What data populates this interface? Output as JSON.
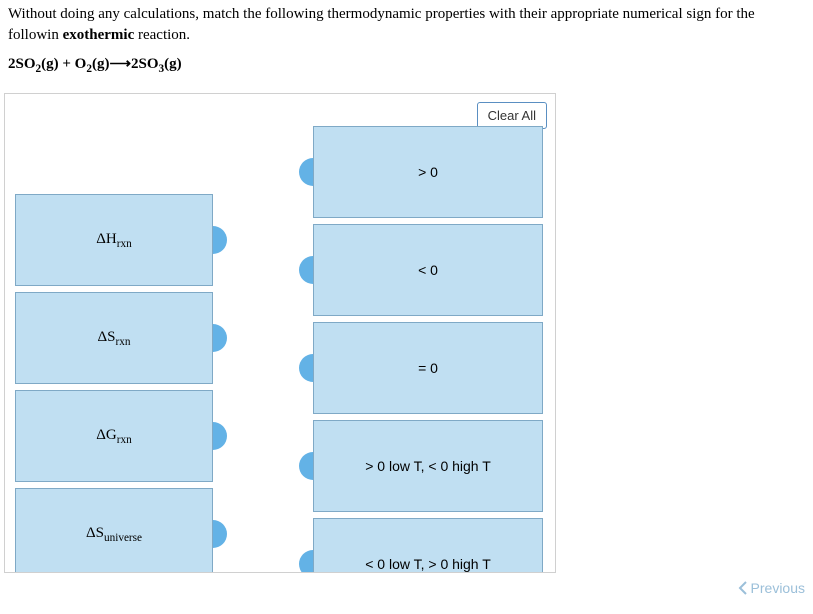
{
  "prompt": {
    "line1a": "Without doing any calculations, match the following thermodynamic properties with their appropriate numerical sign for the followin",
    "line1b_strong": "exothermic",
    "line1c": " reaction."
  },
  "equation": {
    "part1": "2SO",
    "sub1": "2",
    "part2": "(g) + O",
    "sub2": "2",
    "part3": "(g)",
    "arrow": "⟶",
    "part4": "2SO",
    "sub3": "3",
    "part5": "(g)"
  },
  "buttons": {
    "clear_all": "Clear All",
    "previous": "Previous"
  },
  "left_items": [
    {
      "prefix": "ΔH",
      "sub": "rxn"
    },
    {
      "prefix": "ΔS",
      "sub": "rxn"
    },
    {
      "prefix": "ΔG",
      "sub": "rxn"
    },
    {
      "prefix": "ΔS",
      "sub": "universe"
    }
  ],
  "right_items": [
    {
      "label": "> 0"
    },
    {
      "label": "< 0"
    },
    {
      "label": "= 0"
    },
    {
      "label": "> 0 low T, < 0 high T"
    },
    {
      "label": "< 0 low T, > 0 high T"
    }
  ]
}
